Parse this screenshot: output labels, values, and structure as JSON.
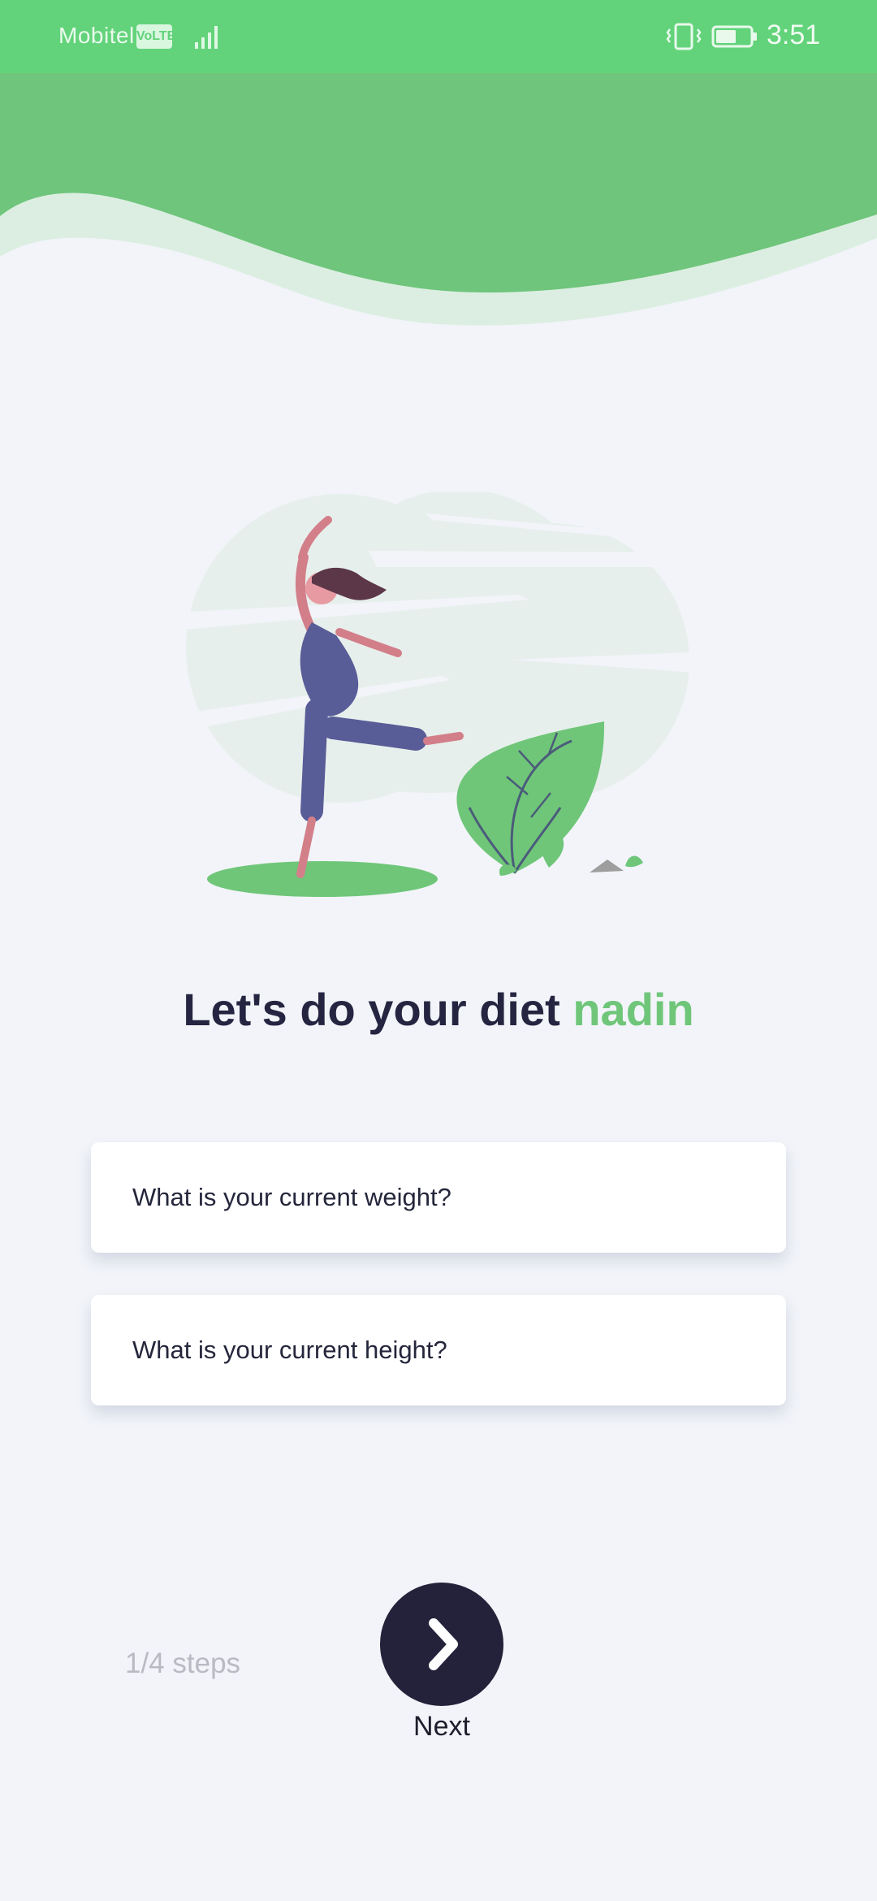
{
  "status_bar": {
    "carrier": "Mobitel",
    "volte_badge": "VoLTE",
    "time": "3:51"
  },
  "greeting": {
    "prefix": "Let's do your diet ",
    "name": "nadin"
  },
  "form": {
    "weight_placeholder": "What is your current weight?",
    "height_placeholder": "What is your current height?"
  },
  "progress": {
    "label": "1/4 steps"
  },
  "next": {
    "label": "Next"
  },
  "theme": {
    "accent": "#6fc679",
    "status_green": "#62d37a",
    "dark": "#23223a",
    "background": "#f2f4f9"
  },
  "icons": {
    "next": "chevron-right-icon",
    "vibrate": "vibrate-icon",
    "battery": "battery-icon",
    "signal": "signal-icon"
  }
}
